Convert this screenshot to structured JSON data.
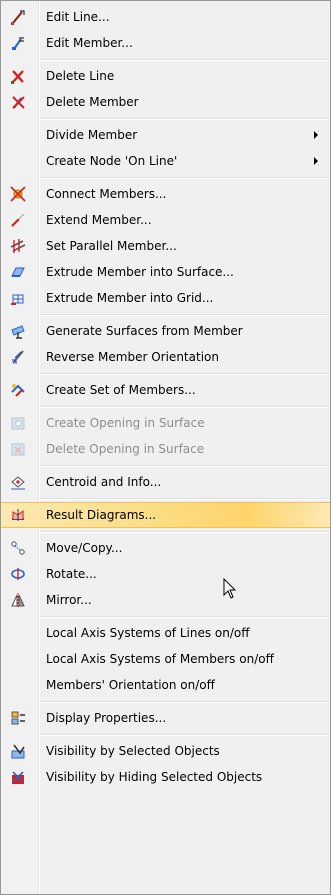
{
  "menu": {
    "groups": [
      [
        {
          "label": "Edit Line...",
          "icon": "edit-line-icon"
        },
        {
          "label": "Edit Member...",
          "icon": "edit-member-icon"
        }
      ],
      [
        {
          "label": "Delete Line",
          "icon": "delete-line-icon"
        },
        {
          "label": "Delete Member",
          "icon": "delete-member-icon"
        }
      ],
      [
        {
          "label": "Divide Member",
          "submenu": true
        },
        {
          "label": "Create Node 'On Line'",
          "submenu": true
        }
      ],
      [
        {
          "label": "Connect Members...",
          "icon": "connect-members-icon"
        },
        {
          "label": "Extend Member...",
          "icon": "extend-member-icon"
        },
        {
          "label": "Set Parallel Member...",
          "icon": "set-parallel-member-icon"
        },
        {
          "label": "Extrude Member into Surface...",
          "icon": "extrude-surface-icon"
        },
        {
          "label": "Extrude Member into Grid...",
          "icon": "extrude-grid-icon"
        }
      ],
      [
        {
          "label": "Generate Surfaces from Member",
          "icon": "generate-surfaces-icon"
        },
        {
          "label": "Reverse Member Orientation",
          "icon": "reverse-orientation-icon"
        }
      ],
      [
        {
          "label": "Create Set of Members...",
          "icon": "create-set-icon"
        }
      ],
      [
        {
          "label": "Create Opening in Surface",
          "icon": "create-opening-icon",
          "disabled": true
        },
        {
          "label": "Delete Opening in Surface",
          "icon": "delete-opening-icon",
          "disabled": true
        }
      ],
      [
        {
          "label": "Centroid and Info...",
          "icon": "centroid-info-icon"
        }
      ],
      [
        {
          "label": "Result Diagrams...",
          "icon": "result-diagrams-icon",
          "highlighted": true
        }
      ],
      [
        {
          "label": "Move/Copy...",
          "icon": "move-copy-icon"
        },
        {
          "label": "Rotate...",
          "icon": "rotate-icon"
        },
        {
          "label": "Mirror...",
          "icon": "mirror-icon"
        }
      ],
      [
        {
          "label": "Local Axis Systems of Lines on/off"
        },
        {
          "label": "Local Axis Systems of Members on/off"
        },
        {
          "label": "Members' Orientation on/off"
        }
      ],
      [
        {
          "label": "Display Properties...",
          "icon": "display-properties-icon"
        }
      ],
      [
        {
          "label": "Visibility by Selected Objects",
          "icon": "visibility-selected-icon"
        },
        {
          "label": "Visibility by Hiding Selected Objects",
          "icon": "visibility-hiding-icon"
        }
      ]
    ]
  },
  "colors": {
    "highlight": "#fbdc82",
    "disabled_text": "#8d8d8d",
    "icon_red": "#d42020",
    "icon_blue": "#2a62c9"
  }
}
